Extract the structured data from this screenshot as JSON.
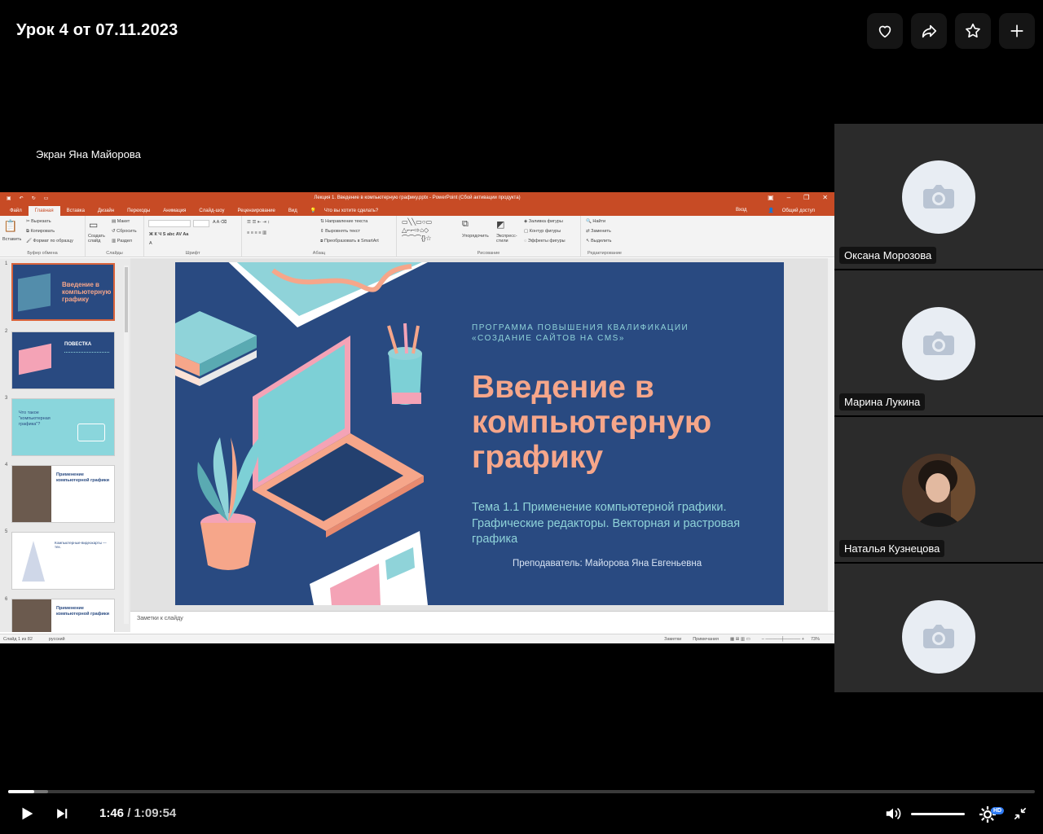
{
  "player": {
    "title": "Урок 4 от 07.11.2023",
    "screen_label": "Экран Яна Майорова",
    "current_time": "1:46",
    "separator": " / ",
    "duration": "1:09:54",
    "progress_fraction": 0.025,
    "quality_badge": "HD",
    "top_buttons": [
      "heart-icon",
      "share-icon",
      "star-icon",
      "plus-icon"
    ]
  },
  "ppt": {
    "document_title": "Лекция 1. Введение в компьютерную графику.pptx - PowerPoint (Сбой активации продукта)",
    "tabs": [
      "Файл",
      "Главная",
      "Вставка",
      "Дизайн",
      "Переходы",
      "Анимация",
      "Слайд-шоу",
      "Рецензирование",
      "Вид"
    ],
    "active_tab": "Главная",
    "tell_me": "Что вы хотите сделать?",
    "sign_in": "Вход",
    "share": "Общий доступ",
    "ribbon": {
      "clipboard": {
        "label": "Буфер обмена",
        "paste": "Вставить",
        "cut": "Вырезать",
        "copy": "Копировать",
        "format": "Формат по образцу"
      },
      "slides": {
        "label": "Слайды",
        "new": "Создать слайд",
        "layout": "Макет",
        "reset": "Сбросить",
        "section": "Раздел"
      },
      "font": {
        "label": "Шрифт"
      },
      "paragraph": {
        "label": "Абзац",
        "text_direction": "Направление текста",
        "align_text": "Выровнять текст",
        "smartart": "Преобразовать в SmartArt"
      },
      "drawing": {
        "label": "Рисование",
        "arrange": "Упорядочить",
        "quick_styles": "Экспресс-стили",
        "fill": "Заливка фигуры",
        "outline": "Контур фигуры",
        "effects": "Эффекты фигуры"
      },
      "editing": {
        "label": "Редактирование",
        "find": "Найти",
        "replace": "Заменить",
        "select": "Выделить"
      }
    },
    "thumbnails": [
      {
        "num": "1",
        "caption": "Введение в компьютерную графику"
      },
      {
        "num": "2",
        "caption": "ПОВЕСТКА"
      },
      {
        "num": "3",
        "caption": "Что такое \"компьютерная графика\"?"
      },
      {
        "num": "4",
        "caption": "Применение компьютерной графики"
      },
      {
        "num": "5",
        "caption": "Компьютерные-видеокарты — тех."
      },
      {
        "num": "6",
        "caption": "Применение компьютерной графики"
      }
    ],
    "slide": {
      "program_line1": "ПРОГРАММА ПОВЫШЕНИЯ КВАЛИФИКАЦИИ",
      "program_line2": "«СОЗДАНИЕ САЙТОВ НА CMS»",
      "title": "Введение в компьютерную графику",
      "topic": "Тема 1.1 Применение компьютерной графики. Графические редакторы. Векторная и растровая графика",
      "teacher": "Преподаватель: Майорова Яна Евгеньевна"
    },
    "notes_placeholder": "Заметки к слайду",
    "status": {
      "slide_of": "Слайд 1 из 82",
      "language": "русский",
      "notes": "Заметки",
      "comments": "Примечания",
      "zoom": "73%"
    }
  },
  "participants": [
    {
      "name": "Оксана Морозова",
      "has_photo": false
    },
    {
      "name": "Марина Лукина",
      "has_photo": false
    },
    {
      "name": "Наталья Кузнецова",
      "has_photo": true
    },
    {
      "name": "",
      "has_photo": false
    }
  ],
  "colors": {
    "ppt_accent": "#c74b25",
    "slide_bg": "#294a81",
    "slide_title": "#f6a68a",
    "slide_cyan": "#8fd3d9"
  }
}
